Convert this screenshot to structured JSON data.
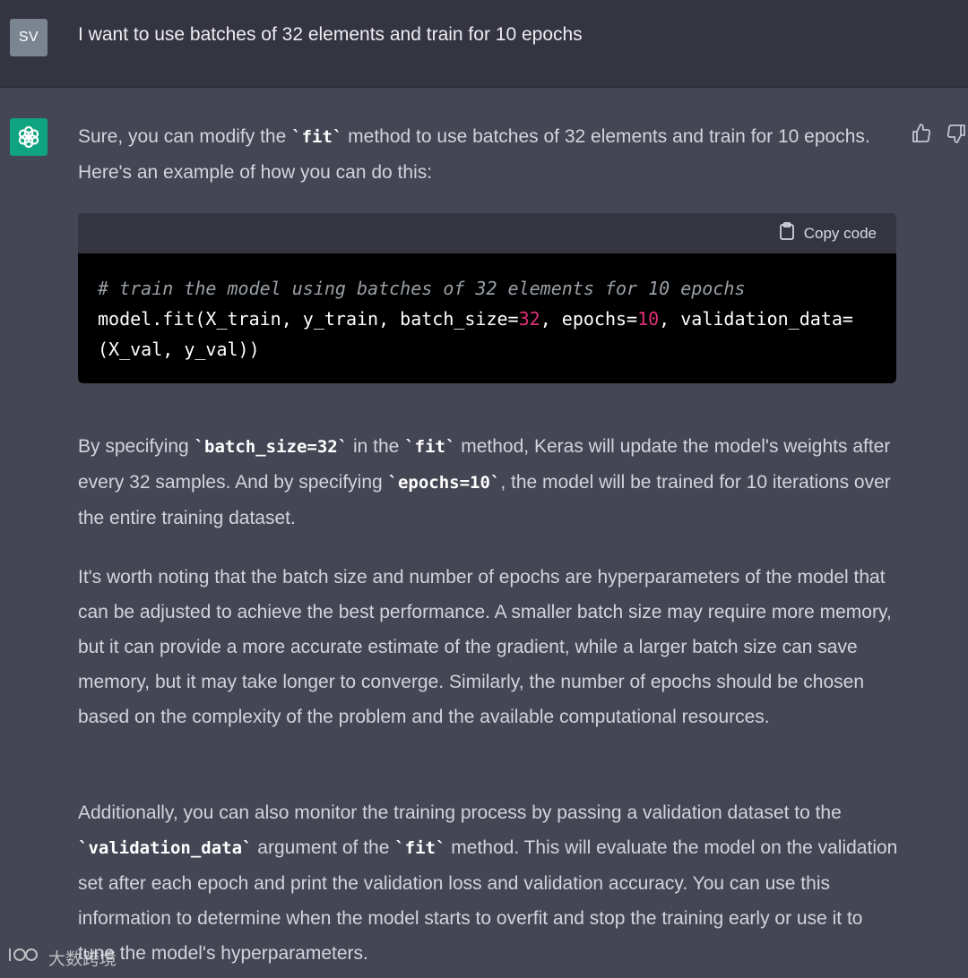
{
  "user": {
    "avatar_initials": "SV",
    "message": "I want to use batches of 32 elements and train for 10 epochs"
  },
  "assistant": {
    "p1": {
      "t1": "Sure, you can modify the ",
      "c1": "`fit`",
      "t2": " method to use batches of 32 elements and train for 10 epochs. Here's an example of how you can do this:"
    },
    "code_block": {
      "copy_label": "Copy code",
      "comment": "# train the model using batches of 32 elements for 10 epochs",
      "line2_a": "model.fit(X_train, y_train, batch_size=",
      "line2_num1": "32",
      "line2_b": ", epochs=",
      "line2_num2": "10",
      "line2_c": ", validation_data=",
      "line3": "(X_val, y_val))"
    },
    "p2": {
      "t1": "By specifying ",
      "c1": "`batch_size=32`",
      "t2": " in the ",
      "c2": "`fit`",
      "t3": " method, Keras will update the model's weights after every 32 samples. And by specifying ",
      "c3": "`epochs=10`",
      "t4": ", the model will be trained for 10 iterations over the entire training dataset."
    },
    "p3": "It's worth noting that the batch size and number of epochs are hyperparameters of the model that can be adjusted to achieve the best performance. A smaller batch size may require more memory, but it can provide a more accurate estimate of the gradient, while a larger batch size can save memory, but it may take longer to converge. Similarly, the number of epochs should be chosen based on the complexity of the problem and the available computational resources.",
    "p4": {
      "t1": "Additionally, you can also monitor the training process by passing a validation dataset to the ",
      "c1": "`validation_data`",
      "t2": " argument of the ",
      "c2": "`fit`",
      "t3": " method. This will evaluate the model on the validation set after each epoch and print the validation loss and validation accuracy. You can use this information to determine when the model starts to overfit and stop the training early or use it to tune the model's hyperparameters."
    }
  },
  "watermark": "大数跨境",
  "icons": {
    "bot_avatar": "openai-logo-icon",
    "thumb_up": "thumbs-up-icon",
    "thumb_down": "thumbs-down-icon",
    "copy": "clipboard-icon"
  },
  "colors": {
    "user_bg": "#343541",
    "assistant_bg": "#444654",
    "bot_avatar_bg": "#10a37f",
    "code_bg": "#000000",
    "code_number": "#df3079"
  }
}
